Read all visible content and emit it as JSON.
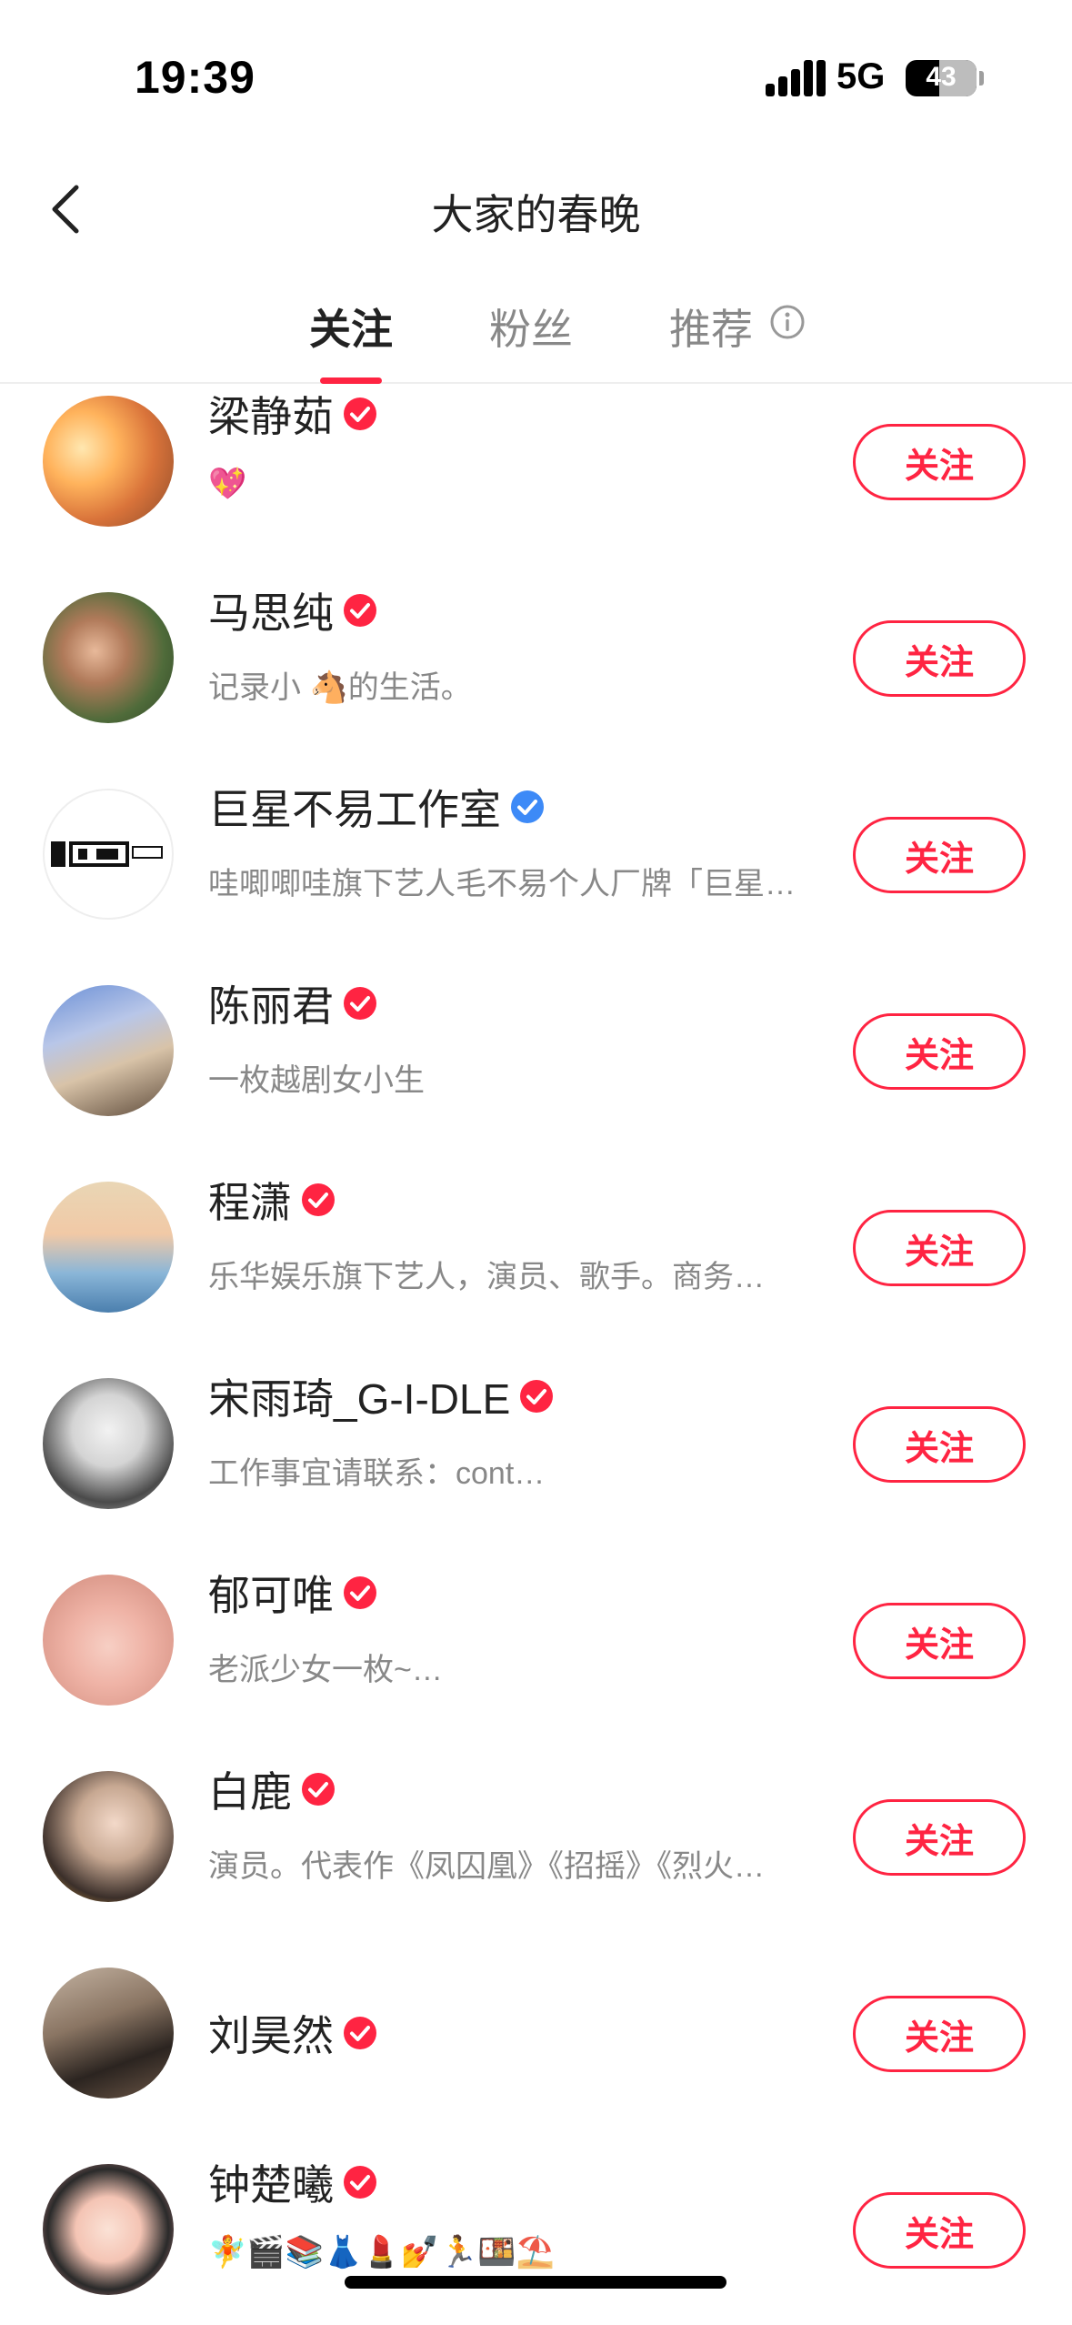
{
  "status_bar": {
    "time": "19:39",
    "network": "5G",
    "battery": "43"
  },
  "nav": {
    "title": "大家的春晚"
  },
  "tabs": [
    {
      "label": "关注",
      "active": true
    },
    {
      "label": "粉丝",
      "active": false
    },
    {
      "label": "推荐",
      "active": false
    }
  ],
  "colors": {
    "accent": "#ff2442",
    "verified_red": "#ff2442",
    "verified_blue": "#3d8af7"
  },
  "users": [
    {
      "name": "梁静茹",
      "desc": "💖",
      "verified": "red",
      "follow_label": "关注"
    },
    {
      "name": "马思纯",
      "desc": "记录小 🐴的生活。",
      "verified": "red",
      "follow_label": "关注"
    },
    {
      "name": "巨星不易工作室",
      "desc": "哇唧唧哇旗下艺人毛不易个人厂牌「巨星…",
      "verified": "blue",
      "follow_label": "关注"
    },
    {
      "name": "陈丽君",
      "desc": "一枚越剧女小生",
      "verified": "red",
      "follow_label": "关注"
    },
    {
      "name": "程潇",
      "desc": "乐华娱乐旗下艺人，演员、歌手。商务…",
      "verified": "red",
      "follow_label": "关注"
    },
    {
      "name": "宋雨琦_G-I-DLE",
      "desc": "工作事宜请联系：cont…",
      "verified": "red",
      "follow_label": "关注"
    },
    {
      "name": "郁可唯",
      "desc": "老派少女一枚~…",
      "verified": "red",
      "follow_label": "关注"
    },
    {
      "name": "白鹿",
      "desc": "演员。代表作《凤囚凰》《招摇》《烈火…",
      "verified": "red",
      "follow_label": "关注"
    },
    {
      "name": "刘昊然",
      "desc": "",
      "verified": "red",
      "follow_label": "关注"
    },
    {
      "name": "钟楚曦",
      "desc": "🧚🎬📚👗💄💅🏃🍱⛱️",
      "verified": "red",
      "follow_label": "关注"
    }
  ]
}
